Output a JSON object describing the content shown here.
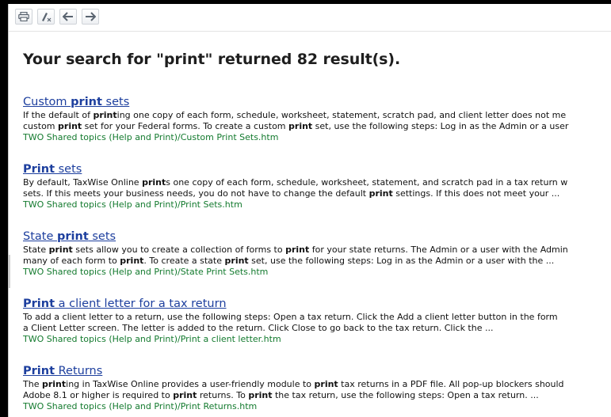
{
  "toolbar": {
    "buttons": [
      {
        "icon": "print-icon"
      },
      {
        "icon": "clear-highlight-icon"
      },
      {
        "icon": "back-icon"
      },
      {
        "icon": "forward-icon"
      }
    ]
  },
  "heading": "Your search for \"print\" returned 82 result(s).",
  "results": [
    {
      "title_pre": "Custom ",
      "title_bold": "print",
      "title_post": " sets",
      "line1": [
        {
          "t": "If the default of "
        },
        {
          "b": "print"
        },
        {
          "t": "ing one copy of each form, schedule, worksheet, statement, scratch pad, and client letter does not me"
        }
      ],
      "line2": [
        {
          "t": "custom "
        },
        {
          "b": "print"
        },
        {
          "t": " set for your Federal forms. To create a custom "
        },
        {
          "b": "print"
        },
        {
          "t": " set, use the following steps: Log in as the Admin or a user"
        }
      ],
      "path": "TWO Shared topics (Help and Print)/Custom Print Sets.htm"
    },
    {
      "title_pre": "",
      "title_bold": "Print",
      "title_post": " sets",
      "line1": [
        {
          "t": "By default, TaxWise Online "
        },
        {
          "b": "print"
        },
        {
          "t": "s one copy of each form, schedule, worksheet, statement, and scratch pad in a tax return w"
        }
      ],
      "line2": [
        {
          "t": "sets. If this meets your business needs, you do not have to change the default "
        },
        {
          "b": "print"
        },
        {
          "t": " settings. If this does not meet your ..."
        }
      ],
      "path": "TWO Shared topics (Help and Print)/Print Sets.htm"
    },
    {
      "title_pre": "State ",
      "title_bold": "print",
      "title_post": " sets",
      "line1": [
        {
          "t": "State "
        },
        {
          "b": "print"
        },
        {
          "t": " sets allow you to create a collection of forms to "
        },
        {
          "b": "print"
        },
        {
          "t": " for your state returns. The Admin or a user with the Admin"
        }
      ],
      "line2": [
        {
          "t": "many of each form to "
        },
        {
          "b": "print"
        },
        {
          "t": ". To create a state "
        },
        {
          "b": "print"
        },
        {
          "t": " set, use the following steps: Log in as the Admin or a user with the ..."
        }
      ],
      "path": "TWO Shared topics (Help and Print)/State Print Sets.htm"
    },
    {
      "title_pre": "",
      "title_bold": "Print",
      "title_post": " a client letter for a tax return",
      "line1": [
        {
          "t": "To add a client letter to a return, use the following steps: Open a tax return. Click the Add a client letter button in the form"
        }
      ],
      "line2": [
        {
          "t": "a Client Letter screen. The letter is added to the return. Click Close to go back to the tax return. Click the ..."
        }
      ],
      "path": "TWO Shared topics (Help and Print)/Print a client letter.htm"
    },
    {
      "title_pre": "",
      "title_bold": "Print",
      "title_post": " Returns",
      "line1": [
        {
          "t": "The "
        },
        {
          "b": "print"
        },
        {
          "t": "ing in TaxWise Online provides a user-friendly module to "
        },
        {
          "b": "print"
        },
        {
          "t": " tax returns in a PDF file. All pop-up blockers should"
        }
      ],
      "line2": [
        {
          "t": "Adobe 8.1 or higher is required to "
        },
        {
          "b": "print"
        },
        {
          "t": " returns. To "
        },
        {
          "b": "print"
        },
        {
          "t": " the tax return, use the following steps: Open a tax return. ..."
        }
      ],
      "path": "TWO Shared topics (Help and Print)/Print Returns.htm"
    }
  ]
}
